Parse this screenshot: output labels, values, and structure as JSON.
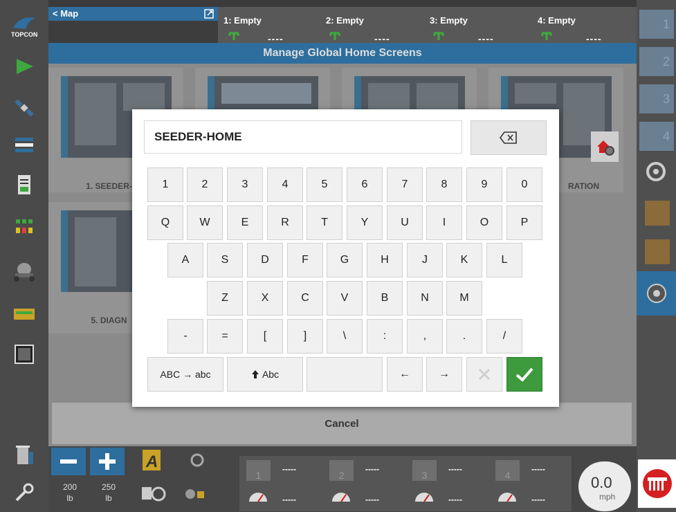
{
  "top_bar": {
    "map_tab_label": "< Map",
    "slots": [
      {
        "label": "1: Empty",
        "value": "----"
      },
      {
        "label": "2: Empty",
        "value": "----"
      },
      {
        "label": "3: Empty",
        "value": "----"
      },
      {
        "label": "4: Empty",
        "value": "----"
      }
    ]
  },
  "right_sidebar": {
    "slots": [
      "1",
      "2",
      "3",
      "4"
    ]
  },
  "dialog_title": "Manage Global Home Screens",
  "cards": [
    {
      "label": "1. SEEDER-"
    },
    {
      "label": "RATION"
    },
    {
      "label": "5. DIAGN"
    }
  ],
  "keyboard": {
    "text_value": "SEEDER-HOME",
    "row1": [
      "1",
      "2",
      "3",
      "4",
      "5",
      "6",
      "7",
      "8",
      "9",
      "0"
    ],
    "row2": [
      "Q",
      "W",
      "E",
      "R",
      "T",
      "Y",
      "U",
      "I",
      "O",
      "P"
    ],
    "row3": [
      "A",
      "S",
      "D",
      "F",
      "G",
      "H",
      "J",
      "K",
      "L"
    ],
    "row4": [
      "Z",
      "X",
      "C",
      "V",
      "B",
      "N",
      "M"
    ],
    "row5": [
      "-",
      "=",
      "[",
      "]",
      "\\",
      ":",
      ",",
      ".",
      "/"
    ],
    "case_toggle_label": "ABC → abc",
    "shift_label": "Abc",
    "left_arrow": "←",
    "right_arrow": "→"
  },
  "cancel_label": "Cancel",
  "bottom_bar": {
    "rate1_value": "200",
    "rate1_unit": "lb",
    "rate2_value": "250",
    "rate2_unit": "lb",
    "section_slots": [
      "1",
      "2",
      "3",
      "4"
    ],
    "section_values": [
      "-----",
      "-----",
      "-----",
      "-----",
      "-----",
      "-----",
      "-----",
      "-----"
    ],
    "speed_value": "0.0",
    "speed_unit": "mph"
  },
  "colors": {
    "header_blue": "#2d6e9e",
    "ok_green": "#3d9a3d",
    "sidebar_slot": "#6b7f93"
  }
}
